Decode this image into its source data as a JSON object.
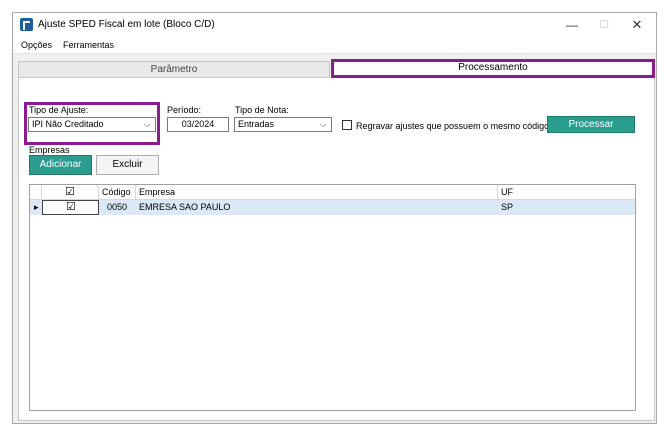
{
  "window": {
    "title": "Ajuste SPED Fiscal em lote (Bloco C/D)",
    "controls": {
      "minimize": "—",
      "maximize": "☐",
      "close": "✕"
    }
  },
  "menu": {
    "items": [
      "Opções",
      "Ferramentas"
    ]
  },
  "tabs": [
    {
      "label": "Parâmetro",
      "active": false
    },
    {
      "label": "Processamento",
      "active": true
    }
  ],
  "form": {
    "tipo_ajuste": {
      "label": "Tipo de Ajuste:",
      "value": "IPI Não Creditado"
    },
    "periodo": {
      "label": "Período:",
      "value": "03/2024"
    },
    "tipo_nota": {
      "label": "Tipo de Nota:",
      "value": "Entradas"
    },
    "regravar": {
      "label": "Regravar ajustes que possuem o mesmo código",
      "checked": false
    },
    "processar_label": "Processar"
  },
  "empresas": {
    "label": "Empresas",
    "add_label": "Adicionar",
    "remove_label": "Excluir",
    "columns": [
      "",
      "Código",
      "Empresa",
      "UF"
    ],
    "rows": [
      {
        "checked": true,
        "codigo": "0050",
        "empresa": "EMRESA SAO PAULO",
        "uf": "SP"
      }
    ]
  },
  "colors": {
    "accent": "#2a9d8f",
    "highlight": "#8b1c8e",
    "row_selected": "#dbe8f7"
  }
}
